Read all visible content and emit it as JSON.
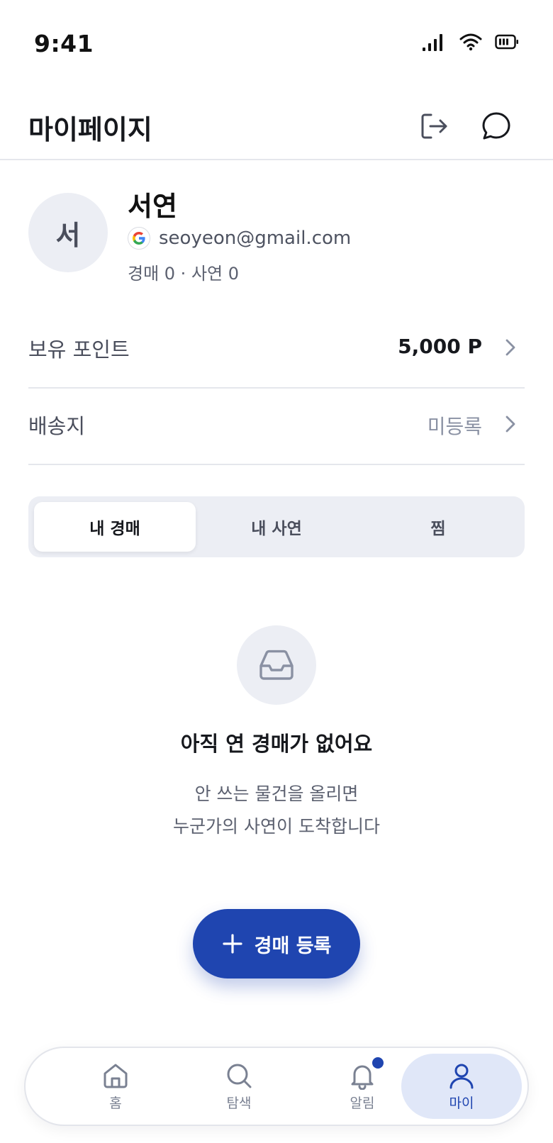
{
  "status_bar": {
    "time": "9:41"
  },
  "header": {
    "title": "마이페이지"
  },
  "profile": {
    "avatar_initial": "서",
    "name": "서연",
    "email": "seoyeon@gmail.com",
    "login_provider_icon": "google-icon",
    "stats": "경매 0 · 사연 0"
  },
  "menu": {
    "points": {
      "label": "보유 포인트",
      "value": "5,000 P"
    },
    "address": {
      "label": "배송지",
      "value": "미등록"
    }
  },
  "tabs": [
    {
      "label": "내 경매",
      "active": true
    },
    {
      "label": "내 사연",
      "active": false
    },
    {
      "label": "찜",
      "active": false
    }
  ],
  "empty_state": {
    "icon": "inbox-icon",
    "title": "아직 연 경매가 없어요",
    "line1": "안 쓰는 물건을 올리면",
    "line2": "누군가의 사연이 도착합니다"
  },
  "fab": {
    "label": "경매 등록",
    "icon": "plus-icon"
  },
  "bottom_nav": [
    {
      "label": "홈",
      "icon": "home-icon",
      "active": false
    },
    {
      "label": "탐색",
      "icon": "search-icon",
      "active": false
    },
    {
      "label": "알림",
      "icon": "bell-icon",
      "active": false,
      "has_badge": true
    },
    {
      "label": "마이",
      "icon": "user-icon",
      "active": true
    }
  ],
  "colors": {
    "primary": "#1f45b0",
    "primary_soft": "#e0e7f8",
    "surface_muted": "#eceef4",
    "text_strong": "#16181d",
    "text_muted": "#8a91a3"
  }
}
